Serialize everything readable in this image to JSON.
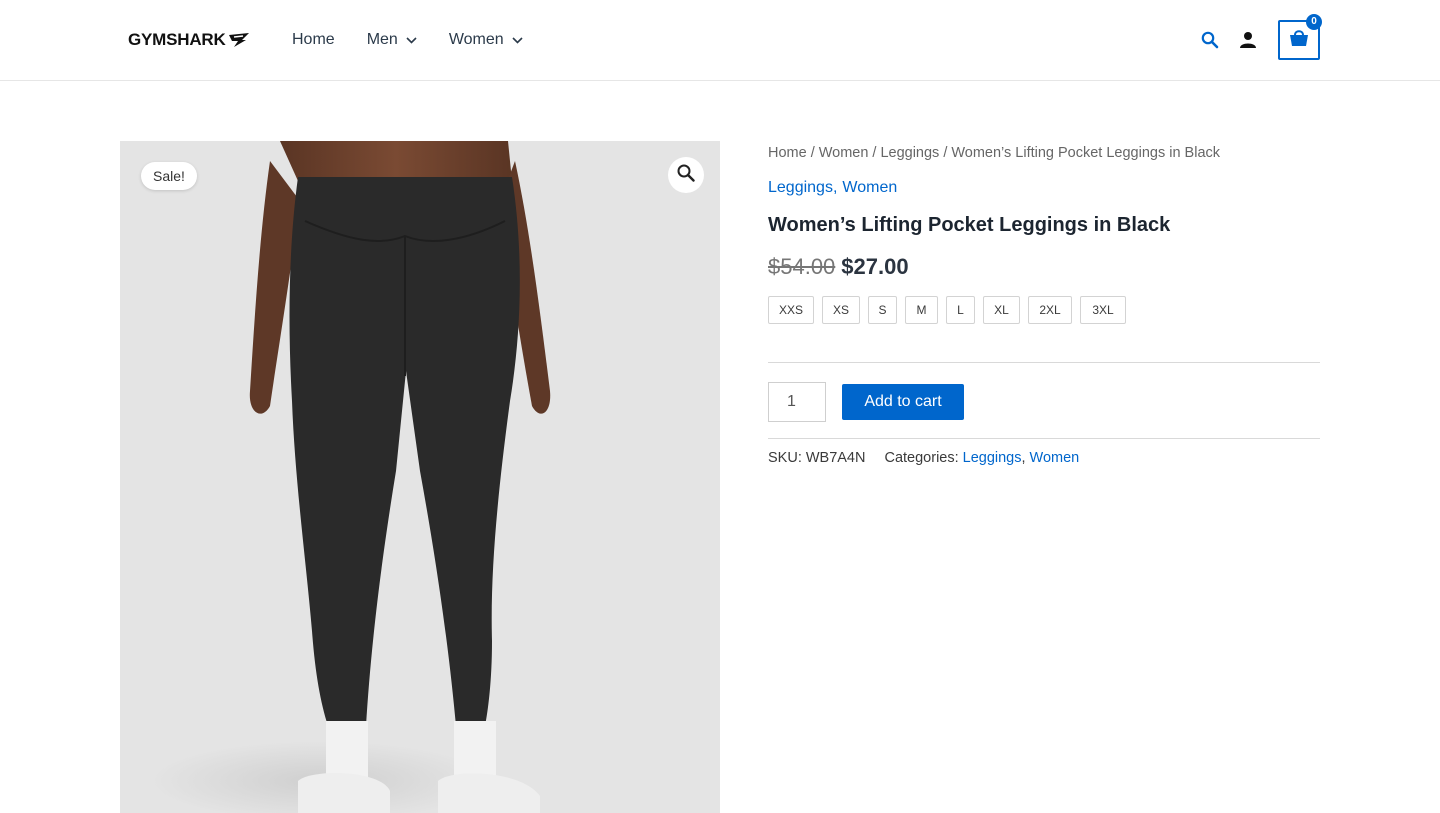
{
  "header": {
    "logo_text": "GYMSHARK",
    "nav": [
      {
        "label": "Home",
        "has_dropdown": false
      },
      {
        "label": "Men",
        "has_dropdown": true
      },
      {
        "label": "Women",
        "has_dropdown": true
      }
    ],
    "cart_count": "0",
    "icons": [
      "search-icon",
      "account-icon",
      "cart-icon"
    ]
  },
  "gallery": {
    "sale_badge": "Sale!",
    "zoom_icon": "magnifier-icon"
  },
  "product": {
    "breadcrumb": [
      {
        "label": "Home"
      },
      {
        "label": "Women"
      },
      {
        "label": "Leggings"
      },
      {
        "label": "Women’s Lifting Pocket Leggings in Black"
      }
    ],
    "breadcrumb_separator": "/",
    "categories": [
      "Leggings",
      "Women"
    ],
    "title": "Women’s Lifting Pocket Leggings in Black",
    "price_old": "$54.00",
    "price_new": "$27.00",
    "sizes": [
      "XXS",
      "XS",
      "S",
      "M",
      "L",
      "XL",
      "2XL",
      "3XL"
    ],
    "quantity": "1",
    "add_to_cart_label": "Add to cart",
    "sku_label": "SKU:",
    "sku_value": "WB7A4N",
    "categories_label": "Categories:",
    "meta_categories": [
      "Leggings",
      "Women"
    ]
  },
  "colors": {
    "accent": "#0066cc",
    "image_bg": "#e4e4e4",
    "leggings": "#2a2a2a"
  }
}
